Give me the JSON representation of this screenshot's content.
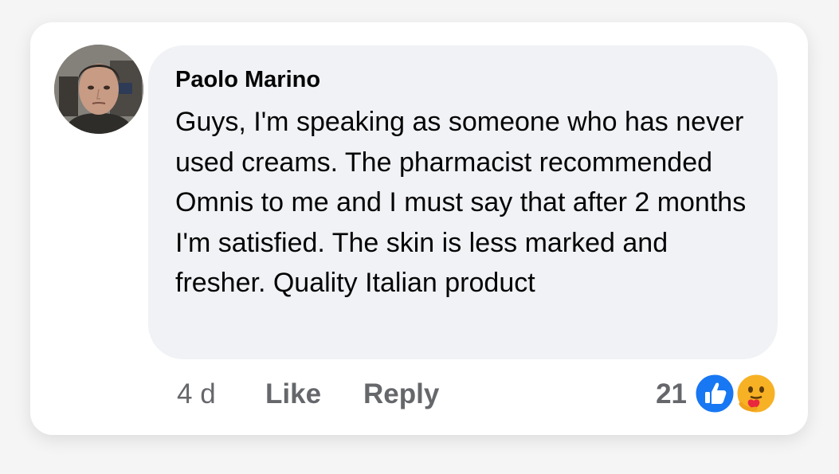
{
  "comment": {
    "author": "Paolo Marino",
    "text": "Guys, I'm speaking as someone who has never used creams. The pharmacist recommended Omnis to me and I must say that after 2 months I'm satisfied. The skin is less marked and fresher. Quality Italian product"
  },
  "actions": {
    "timestamp": "4 d",
    "like_label": "Like",
    "reply_label": "Reply"
  },
  "reactions": {
    "count": "21",
    "icons": [
      "like-reaction-icon",
      "care-reaction-icon"
    ]
  },
  "colors": {
    "bubble": "#f0f2f5",
    "secondary_text": "#65676b",
    "like_blue": "#1877f2",
    "care_yellow": "#f7b125"
  }
}
